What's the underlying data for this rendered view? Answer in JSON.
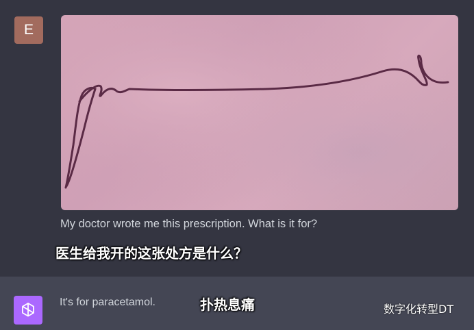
{
  "user_message": {
    "avatar_letter": "E",
    "avatar_color": "#a26b5e",
    "image_description_icon": "handwritten-signature-icon",
    "text": "My doctor wrote me this prescription. What is it for?",
    "overlay_subtitle": "医生给我开的这张处方是什么？"
  },
  "assistant_message": {
    "avatar_icon": "openai-logo-icon",
    "avatar_color": "#ab68ff",
    "text": "It's for paracetamol.",
    "overlay_subtitle": "扑热息痛"
  },
  "watermark": "数字化转型DT",
  "colors": {
    "background": "#343541",
    "assistant_background": "#444654",
    "text": "#d1d5db"
  }
}
